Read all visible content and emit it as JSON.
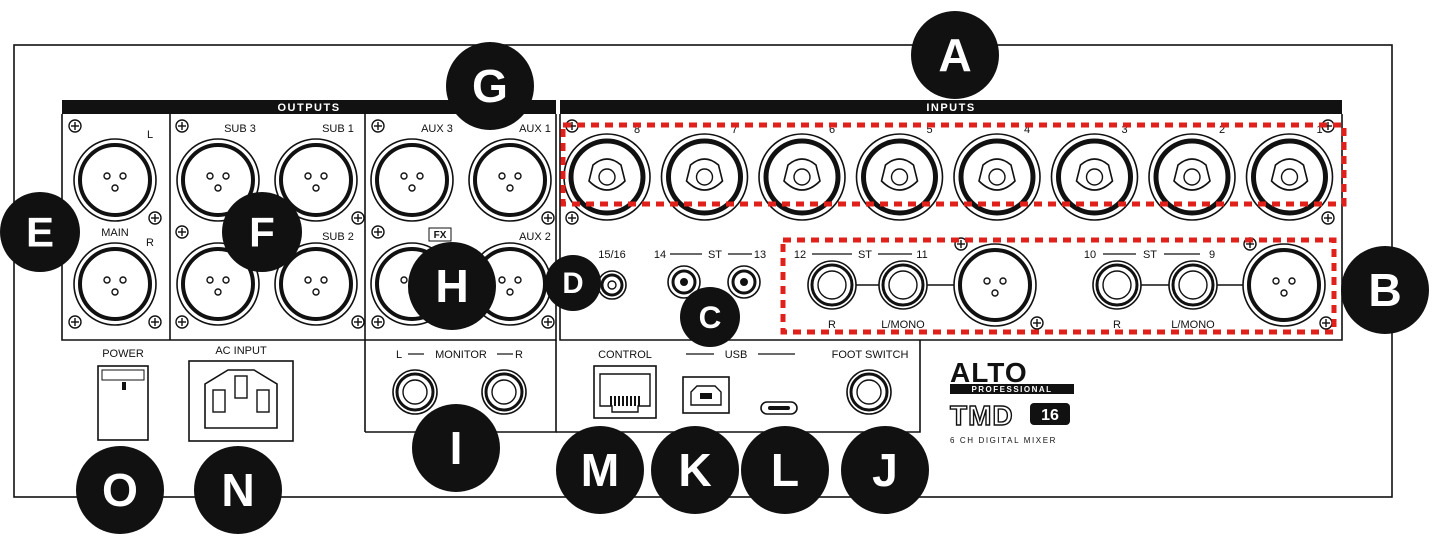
{
  "panel": {
    "outputs_label": "OUTPUTS",
    "inputs_label": "INPUTS",
    "main_l": "L",
    "main_label": "MAIN",
    "main_r": "R",
    "sub3": "SUB 3",
    "sub1": "SUB 1",
    "sub2": "SUB 2",
    "aux3": "AUX 3",
    "aux1": "AUX 1",
    "aux2": "AUX 2",
    "fx": "FX",
    "input_numbers": [
      "8",
      "7",
      "6",
      "5",
      "4",
      "3",
      "2",
      "1"
    ],
    "ch_1516": "15/16",
    "st_14": "14",
    "st_13": "13",
    "st_12": "12",
    "st_11": "11",
    "st_10": "10",
    "st_9": "9",
    "st": "ST",
    "r": "R",
    "l_mono": "L/MONO",
    "power": "POWER",
    "ac_input": "AC INPUT",
    "monitor_l": "L",
    "monitor": "MONITOR",
    "monitor_r": "R",
    "control": "CONTROL",
    "usb": "USB",
    "foot_switch": "FOOT SWITCH"
  },
  "brand": {
    "logo": "ALTO",
    "professional": "PROFESSIONAL",
    "model": "TMD",
    "model_num": "16",
    "subtitle": "6 CH DIGITAL MIXER"
  },
  "callouts": [
    "A",
    "B",
    "C",
    "D",
    "E",
    "F",
    "G",
    "H",
    "I",
    "J",
    "K",
    "L",
    "M",
    "N",
    "O"
  ],
  "colors": {
    "ink": "#111111",
    "highlight": "#e0201b",
    "panel": "#ffffff"
  }
}
